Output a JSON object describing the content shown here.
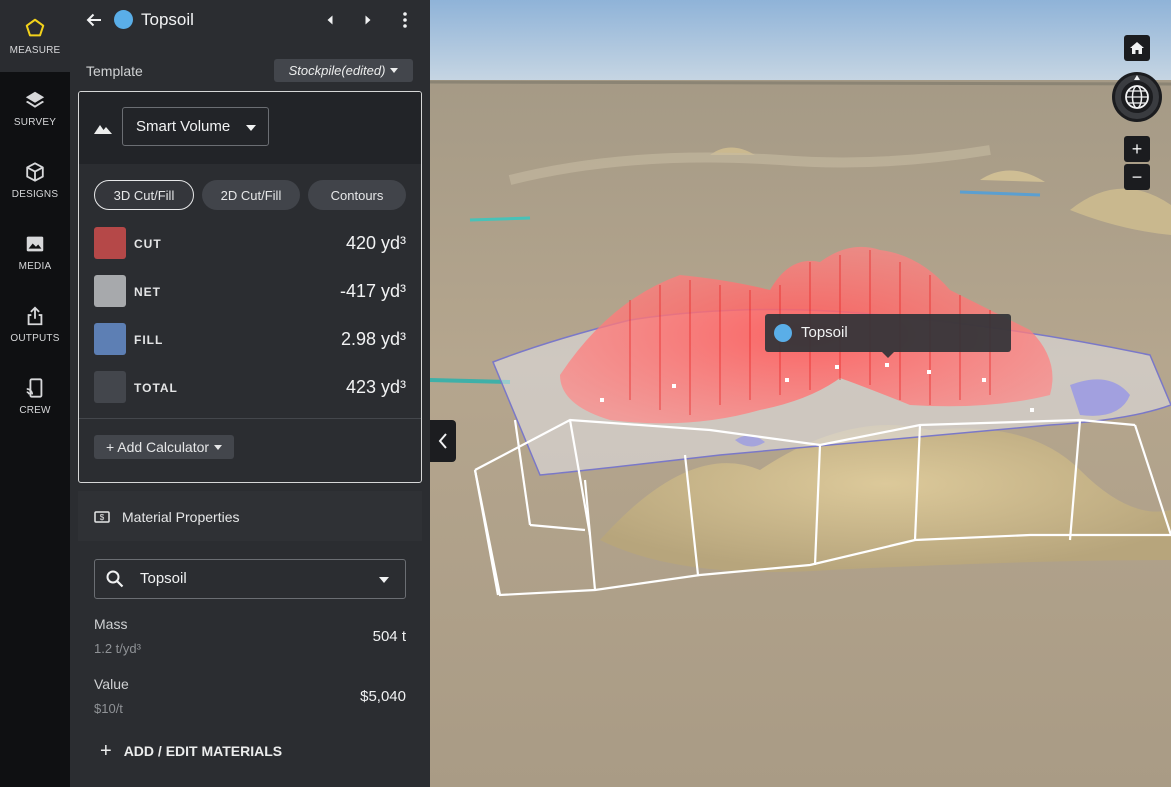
{
  "rail": {
    "items": [
      {
        "label": "MEASURE",
        "icon": "pentagon-icon"
      },
      {
        "label": "SURVEY",
        "icon": "layers-icon"
      },
      {
        "label": "DESIGNS",
        "icon": "cube-icon"
      },
      {
        "label": "MEDIA",
        "icon": "image-icon"
      },
      {
        "label": "OUTPUTS",
        "icon": "export-icon"
      },
      {
        "label": "CREW",
        "icon": "crew-device-icon"
      }
    ]
  },
  "header": {
    "title": "Topsoil",
    "dot_color": "#5aaee8"
  },
  "template": {
    "label": "Template",
    "value": "Stockpile(edited)"
  },
  "calculator": {
    "type": "Smart Volume",
    "tabs": [
      "3D Cut/Fill",
      "2D Cut/Fill",
      "Contours"
    ],
    "active_tab": "3D Cut/Fill",
    "rows": [
      {
        "name": "CUT",
        "value": "420 yd³",
        "color": "#b54848"
      },
      {
        "name": "NET",
        "value": "-417 yd³",
        "color": "#a7a9ac"
      },
      {
        "name": "FILL",
        "value": "2.98 yd³",
        "color": "#5d7fb4"
      },
      {
        "name": "TOTAL",
        "value": "423 yd³",
        "color": "#43464c"
      }
    ],
    "add_label": "+ Add Calculator"
  },
  "material": {
    "header": "Material Properties",
    "selected": "Topsoil",
    "mass_label": "Mass",
    "mass_rate": "1.2 t/yd³",
    "mass_value": "504 t",
    "value_label": "Value",
    "value_rate": "$10/t",
    "value_value": "$5,040",
    "add_edit": "ADD / EDIT MATERIALS"
  },
  "viewport": {
    "label": "Topsoil"
  }
}
